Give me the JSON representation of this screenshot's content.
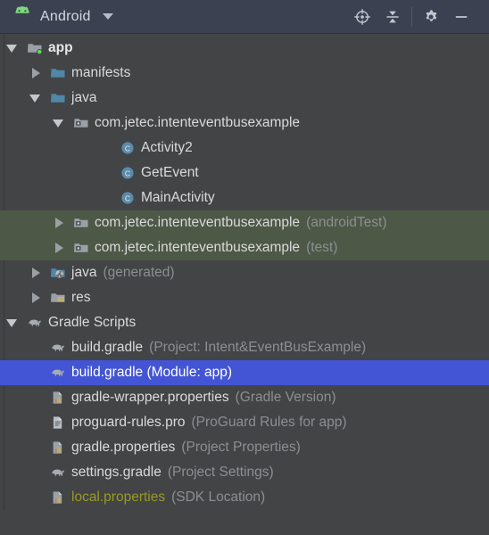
{
  "header": {
    "title": "Android",
    "logo_icon": "android-robot-icon",
    "dropdown_icon": "chevron-down-icon",
    "buttons": [
      {
        "name": "select-opened-file-button",
        "icon": "crosshair-target-icon"
      },
      {
        "name": "collapse-all-button",
        "icon": "collapse-all-icon"
      },
      {
        "name": "settings-button",
        "icon": "gear-icon"
      },
      {
        "name": "hide-button",
        "icon": "minimize-dash-icon"
      }
    ]
  },
  "colors": {
    "header_bg": "#3c4152",
    "panel_bg": "#424446",
    "selection_bg": "#4355d4",
    "test_source_bg": "#4e5847",
    "android_green": "#7ed97e",
    "folder_blue": "#4f87a8",
    "class_blue": "#5b8bab",
    "ignored_yellow": "#9a9a22",
    "text": "#d9dadb",
    "text_muted": "#8c8f91"
  },
  "tree": {
    "rows": [
      {
        "id": "app",
        "indent": 0,
        "toggle": "open",
        "icon": "module-folder-icon",
        "label": "app",
        "sub": "",
        "bold": true,
        "style": "normal"
      },
      {
        "id": "manifests",
        "indent": 1,
        "toggle": "closed",
        "icon": "folder-icon",
        "label": "manifests",
        "sub": "",
        "bold": false,
        "style": "normal"
      },
      {
        "id": "java",
        "indent": 1,
        "toggle": "open",
        "icon": "folder-icon",
        "label": "java",
        "sub": "",
        "bold": false,
        "style": "normal"
      },
      {
        "id": "package-main",
        "indent": 2,
        "toggle": "open",
        "icon": "package-folder-icon",
        "label": "com.jetec.intenteventbusexample",
        "sub": "",
        "bold": false,
        "style": "normal"
      },
      {
        "id": "class-activity2",
        "indent": 4,
        "toggle": "none",
        "icon": "java-class-icon",
        "label": "Activity2",
        "sub": "",
        "bold": false,
        "style": "normal"
      },
      {
        "id": "class-getevent",
        "indent": 4,
        "toggle": "none",
        "icon": "java-class-icon",
        "label": "GetEvent",
        "sub": "",
        "bold": false,
        "style": "normal"
      },
      {
        "id": "class-mainactivity",
        "indent": 4,
        "toggle": "none",
        "icon": "java-class-icon",
        "label": "MainActivity",
        "sub": "",
        "bold": false,
        "style": "normal"
      },
      {
        "id": "package-androidtest",
        "indent": 2,
        "toggle": "closed",
        "icon": "package-folder-icon",
        "label": "com.jetec.intenteventbusexample",
        "sub": "(androidTest)",
        "bold": false,
        "style": "test"
      },
      {
        "id": "package-test",
        "indent": 2,
        "toggle": "closed",
        "icon": "package-folder-icon",
        "label": "com.jetec.intenteventbusexample",
        "sub": "(test)",
        "bold": false,
        "style": "test"
      },
      {
        "id": "java-generated",
        "indent": 1,
        "toggle": "closed",
        "icon": "generated-folder-icon",
        "label": "java",
        "sub": "(generated)",
        "bold": false,
        "style": "normal"
      },
      {
        "id": "res",
        "indent": 1,
        "toggle": "closed",
        "icon": "res-folder-icon",
        "label": "res",
        "sub": "",
        "bold": false,
        "style": "normal"
      },
      {
        "id": "gradle-scripts",
        "indent": 0,
        "toggle": "open",
        "icon": "gradle-elephant-icon",
        "label": "Gradle Scripts",
        "sub": "",
        "bold": false,
        "style": "normal"
      },
      {
        "id": "build-gradle-project",
        "indent": 1,
        "toggle": "none",
        "icon": "gradle-elephant-icon",
        "label": "build.gradle",
        "sub": "(Project: Intent&EventBusExample)",
        "bold": false,
        "style": "normal"
      },
      {
        "id": "build-gradle-module",
        "indent": 1,
        "toggle": "none",
        "icon": "gradle-elephant-icon",
        "label": "build.gradle (Module: app)",
        "sub": "",
        "bold": false,
        "style": "selected"
      },
      {
        "id": "gradle-wrapper-properties",
        "indent": 1,
        "toggle": "none",
        "icon": "properties-file-icon",
        "label": "gradle-wrapper.properties",
        "sub": "(Gradle Version)",
        "bold": false,
        "style": "normal"
      },
      {
        "id": "proguard-rules-pro",
        "indent": 1,
        "toggle": "none",
        "icon": "text-file-icon",
        "label": "proguard-rules.pro",
        "sub": "(ProGuard Rules for app)",
        "bold": false,
        "style": "normal"
      },
      {
        "id": "gradle-properties",
        "indent": 1,
        "toggle": "none",
        "icon": "properties-file-icon",
        "label": "gradle.properties",
        "sub": "(Project Properties)",
        "bold": false,
        "style": "normal"
      },
      {
        "id": "settings-gradle",
        "indent": 1,
        "toggle": "none",
        "icon": "gradle-elephant-icon",
        "label": "settings.gradle",
        "sub": "(Project Settings)",
        "bold": false,
        "style": "normal"
      },
      {
        "id": "local-properties",
        "indent": 1,
        "toggle": "none",
        "icon": "properties-file-icon",
        "label": "local.properties",
        "sub": "(SDK Location)",
        "bold": false,
        "style": "ignored"
      }
    ]
  }
}
